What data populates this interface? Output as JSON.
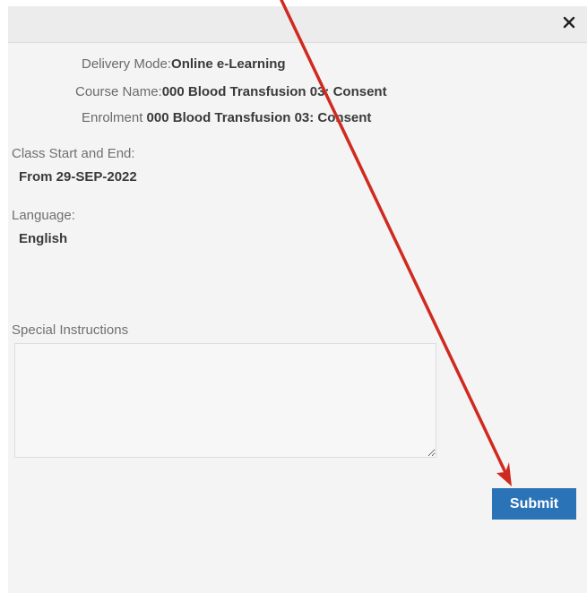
{
  "course": {
    "delivery_mode_label": "Delivery Mode:",
    "delivery_mode_value": "Online e-Learning",
    "course_name_label": "Course Name:",
    "course_name_value": "000 Blood Transfusion 03: Consent",
    "enrolment_label": "Enrolment",
    "enrolment_value": "000 Blood Transfusion 03: Consent"
  },
  "class_dates": {
    "label": "Class Start and End:",
    "value": "From 29-SEP-2022"
  },
  "language": {
    "label": "Language:",
    "value": "English"
  },
  "special_instructions": {
    "label": "Special Instructions",
    "value": ""
  },
  "actions": {
    "submit_label": "Submit",
    "close_label": "×"
  },
  "colors": {
    "submit_background": "#2b73b7",
    "annotation_arrow": "#d02a20"
  }
}
